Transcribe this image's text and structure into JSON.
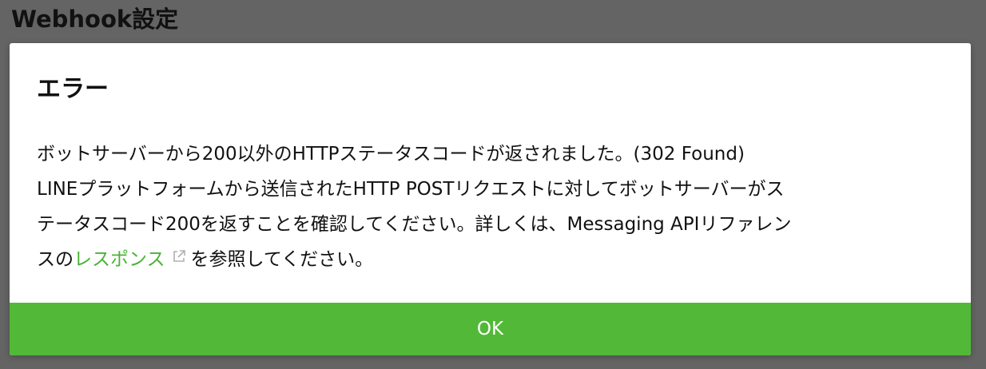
{
  "page": {
    "header_title": "Webhook設定"
  },
  "dialog": {
    "title": "エラー",
    "body": {
      "line1": "ボットサーバーから200以外のHTTPステータスコードが返されました。(302 Found)",
      "line2": "LINEプラットフォームから送信されたHTTP POSTリクエストに対してボットサーバーがス",
      "line3": "テータスコード200を返すことを確認してください。詳しくは、Messaging APIリファレン",
      "line4_prefix": "スの",
      "link_label": "レスポンス",
      "line4_suffix": "を参照してください。"
    },
    "link_icon": "external-link-icon",
    "ok_label": "OK"
  },
  "colors": {
    "overlay": "#646464",
    "link": "#4bb336",
    "ok_button": "#52b838",
    "text": "#111111"
  }
}
